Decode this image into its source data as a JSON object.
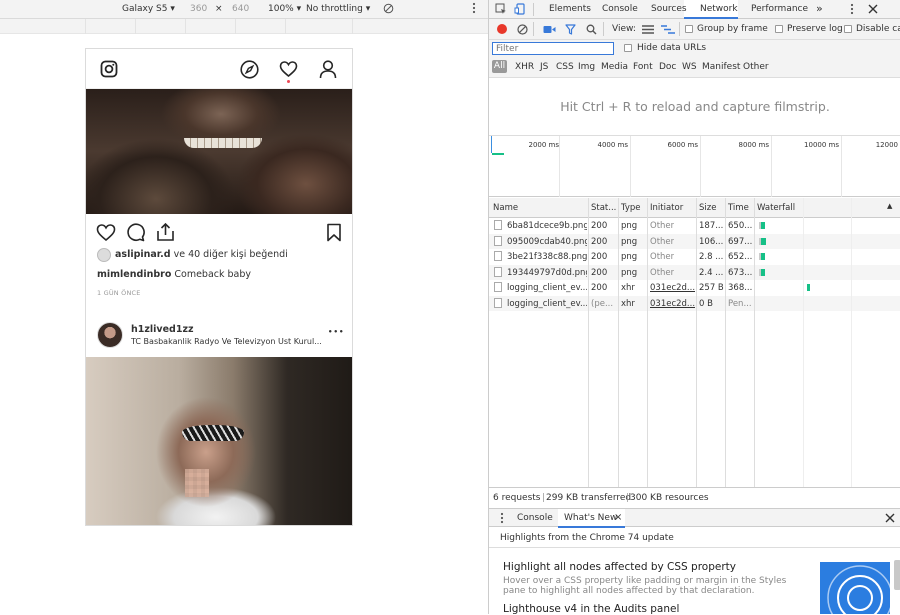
{
  "device_toolbar": {
    "device": "Galaxy S5",
    "width": "360",
    "times": "×",
    "height": "640",
    "zoom": "100%",
    "throttle": "No throttling"
  },
  "instagram": {
    "post1": {
      "likes_user": "aslipinar.d",
      "likes_text": " ve 40 diğer kişi beğendi",
      "caption_user": "mimlendinbro",
      "caption_text": " Comeback baby",
      "time": "1 GÜN ÖNCE"
    },
    "post2": {
      "username": "h1zlived1zz",
      "location": "TC Basbakanlik Radyo Ve Televizyon Ust Kurul...",
      "more": "•••"
    }
  },
  "devtools": {
    "tabs": [
      "Elements",
      "Console",
      "Sources",
      "Network",
      "Performance"
    ],
    "more_tabs": "»",
    "toolbar": {
      "view_label": "View:",
      "group_by_frame": "Group by frame",
      "preserve_log": "Preserve log",
      "disable_cache": "Disable cac"
    },
    "filter": {
      "placeholder": "Filter",
      "hide_data_urls": "Hide data URLs",
      "types": [
        "All",
        "XHR",
        "JS",
        "CSS",
        "Img",
        "Media",
        "Font",
        "Doc",
        "WS",
        "Manifest",
        "Other"
      ]
    },
    "filmstrip_message": "Hit Ctrl + R to reload and capture filmstrip.",
    "overview_ticks": [
      "2000 ms",
      "4000 ms",
      "6000 ms",
      "8000 ms",
      "10000 ms",
      "12000"
    ],
    "table": {
      "headers": [
        "Name",
        "Stat...",
        "Type",
        "Initiator",
        "Size",
        "Time",
        "Waterfall"
      ],
      "rows": [
        {
          "name": "6ba81dcece9b.png",
          "status": "200",
          "type": "png",
          "initiator": "Other",
          "size": "187...",
          "time": "650..."
        },
        {
          "name": "095009cdab40.png",
          "status": "200",
          "type": "png",
          "initiator": "Other",
          "size": "106...",
          "time": "697..."
        },
        {
          "name": "3be21f338c88.png",
          "status": "200",
          "type": "png",
          "initiator": "Other",
          "size": "2.8 ...",
          "time": "652..."
        },
        {
          "name": "193449797d0d.png",
          "status": "200",
          "type": "png",
          "initiator": "Other",
          "size": "2.4 ...",
          "time": "673..."
        },
        {
          "name": "logging_client_ev...",
          "status": "200",
          "type": "xhr",
          "initiator": "031ec2d...",
          "size": "257 B",
          "time": "368..."
        },
        {
          "name": "logging_client_ev...",
          "status": "(pe...",
          "type": "xhr",
          "initiator": "031ec2d...",
          "size": "0 B",
          "time": "Pen..."
        }
      ]
    },
    "status_bar": {
      "requests": "6 requests",
      "transferred": "299 KB transferred",
      "resources": "300 KB resources",
      "separator": "|"
    },
    "drawer": {
      "tabs": [
        "Console",
        "What's New"
      ],
      "close": "×",
      "header": "Highlights from the Chrome 74 update",
      "items": [
        {
          "title": "Highlight all nodes affected by CSS property",
          "desc": "Hover over a CSS property like padding or margin in the Styles pane to highlight all nodes affected by that declaration."
        },
        {
          "title": "Lighthouse v4 in the Audits panel",
          "desc": ""
        }
      ]
    },
    "colors": {
      "accent": "#3879d9",
      "record": "#e8372a",
      "waterfall_green": "#16c087",
      "waterfall_blue": "#3b8fe0"
    }
  }
}
